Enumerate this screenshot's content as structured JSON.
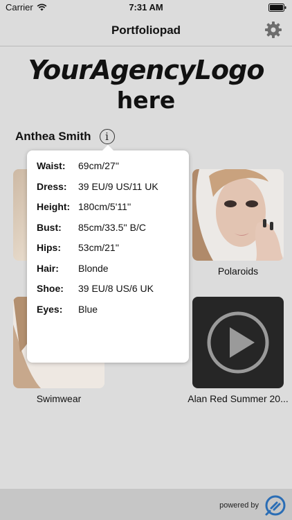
{
  "status": {
    "carrier": "Carrier",
    "time": "7:31 AM"
  },
  "nav": {
    "title": "Portfoliopad",
    "settings_icon": "gear-icon"
  },
  "logo": {
    "line1": "YourAgencyLogo",
    "line2": "here"
  },
  "model": {
    "name": "Anthea Smith",
    "info_icon": "info-icon"
  },
  "gallery": [
    {
      "caption": "Polaroids"
    },
    {
      "caption": "Swimwear"
    },
    {
      "caption": "Alan Red Summer 20..."
    }
  ],
  "stats": [
    {
      "key": "Waist:",
      "value": "69cm/27''"
    },
    {
      "key": "Dress:",
      "value": "39 EU/9 US/11 UK"
    },
    {
      "key": "Height:",
      "value": "180cm/5'11''"
    },
    {
      "key": "Bust:",
      "value": "85cm/33.5'' B/C"
    },
    {
      "key": "Hips:",
      "value": "53cm/21''"
    },
    {
      "key": "Hair:",
      "value": "Blonde"
    },
    {
      "key": "Shoe:",
      "value": "39 EU/8 US/6 UK"
    },
    {
      "key": "Eyes:",
      "value": "Blue"
    }
  ],
  "footer": {
    "powered_by": "powered by"
  },
  "colors": {
    "background": "#dcdcdc",
    "footer": "#c6c6c6",
    "popover": "#ffffff",
    "brand": "#2a6db5"
  }
}
